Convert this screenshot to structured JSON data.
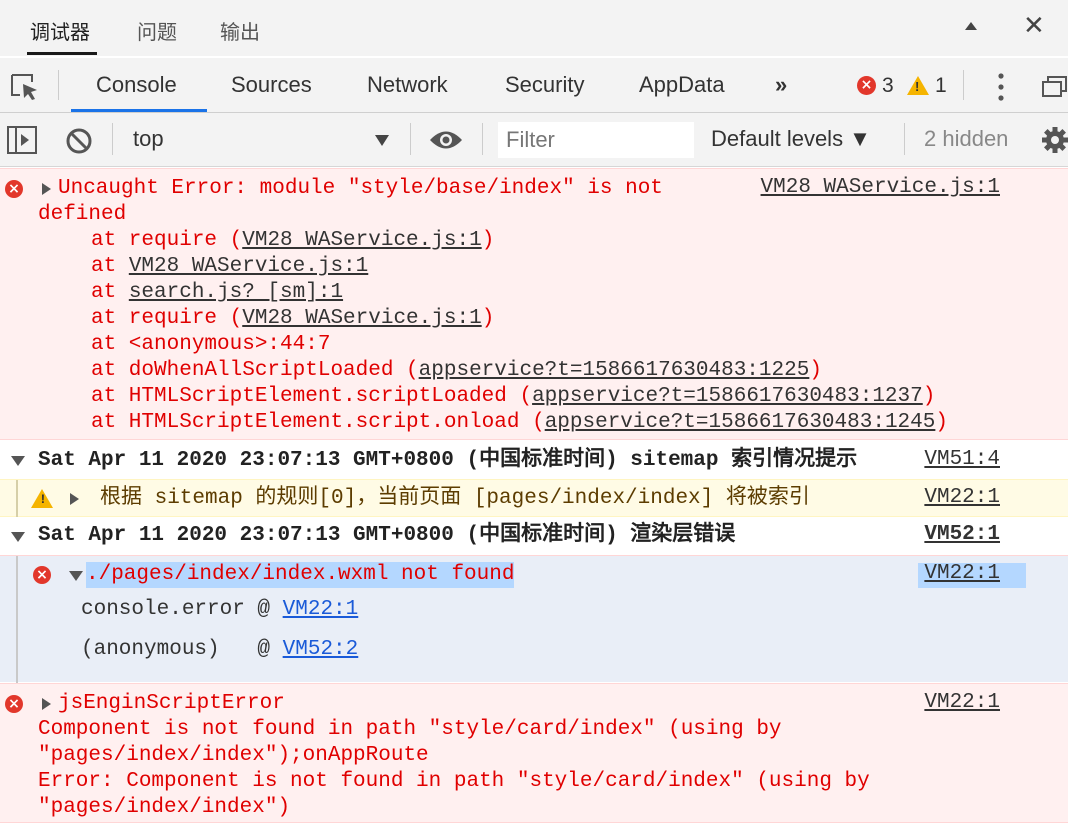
{
  "wechat_tabs": [
    "调试器",
    "问题",
    "输出"
  ],
  "devtools_tabs": [
    "Console",
    "Sources",
    "Network",
    "Security",
    "AppData"
  ],
  "more_tabs_icon": "»",
  "counts": {
    "errors": "3",
    "warnings": "1"
  },
  "toolbar": {
    "context": "top",
    "filter_placeholder": "Filter",
    "levels": "Default levels ▼",
    "hidden": "2 hidden"
  },
  "messages": {
    "error1": {
      "head_line1": "Uncaught Error: module \"style/base/index\" is not",
      "head_line2": "defined",
      "source": "VM28 WAService.js:1",
      "stack": [
        {
          "prefix": "at require (",
          "link": "VM28 WAService.js:1",
          "suffix": ")"
        },
        {
          "prefix": "at ",
          "link": "VM28 WAService.js:1",
          "suffix": ""
        },
        {
          "prefix": "at ",
          "link": "search.js? [sm]:1",
          "suffix": ""
        },
        {
          "prefix": "at require (",
          "link": "VM28 WAService.js:1",
          "suffix": ")"
        },
        {
          "prefix": "at <anonymous>:44:7",
          "link": "",
          "suffix": ""
        },
        {
          "prefix": "at doWhenAllScriptLoaded (",
          "link": "appservice?t=1586617630483:1225",
          "suffix": ")"
        },
        {
          "prefix": "at HTMLScriptElement.scriptLoaded (",
          "link": "appservice?t=1586617630483:1237",
          "suffix": ")"
        },
        {
          "prefix": "at HTMLScriptElement.script.onload (",
          "link": "appservice?t=1586617630483:1245",
          "suffix": ")"
        }
      ]
    },
    "group1": {
      "title": "Sat Apr 11 2020 23:07:13 GMT+0800 (中国标准时间) sitemap 索引情况提示",
      "source": "VM51:4"
    },
    "warning1": {
      "text": "根据 sitemap 的规则[0]，当前页面 [pages/index/index] 将被索引",
      "source": "VM22:1"
    },
    "group2": {
      "title": "Sat Apr 11 2020 23:07:13 GMT+0800 (中国标准时间) 渲染层错误",
      "source": "VM52:1"
    },
    "error2": {
      "text": "./pages/index/index.wxml not found",
      "source": "VM22:1",
      "frames": [
        {
          "fn": "console.error @ ",
          "link": "VM22:1"
        },
        {
          "fn": "(anonymous)   @ ",
          "link": "VM52:2"
        }
      ]
    },
    "error3": {
      "head": "jsEnginScriptError",
      "source": "VM22:1",
      "lines": [
        "Component is not found in path \"style/card/index\" (using by",
        "\"pages/index/index\");onAppRoute",
        "Error: Component is not found in path \"style/card/index\" (using by",
        "\"pages/index/index\")"
      ]
    }
  }
}
